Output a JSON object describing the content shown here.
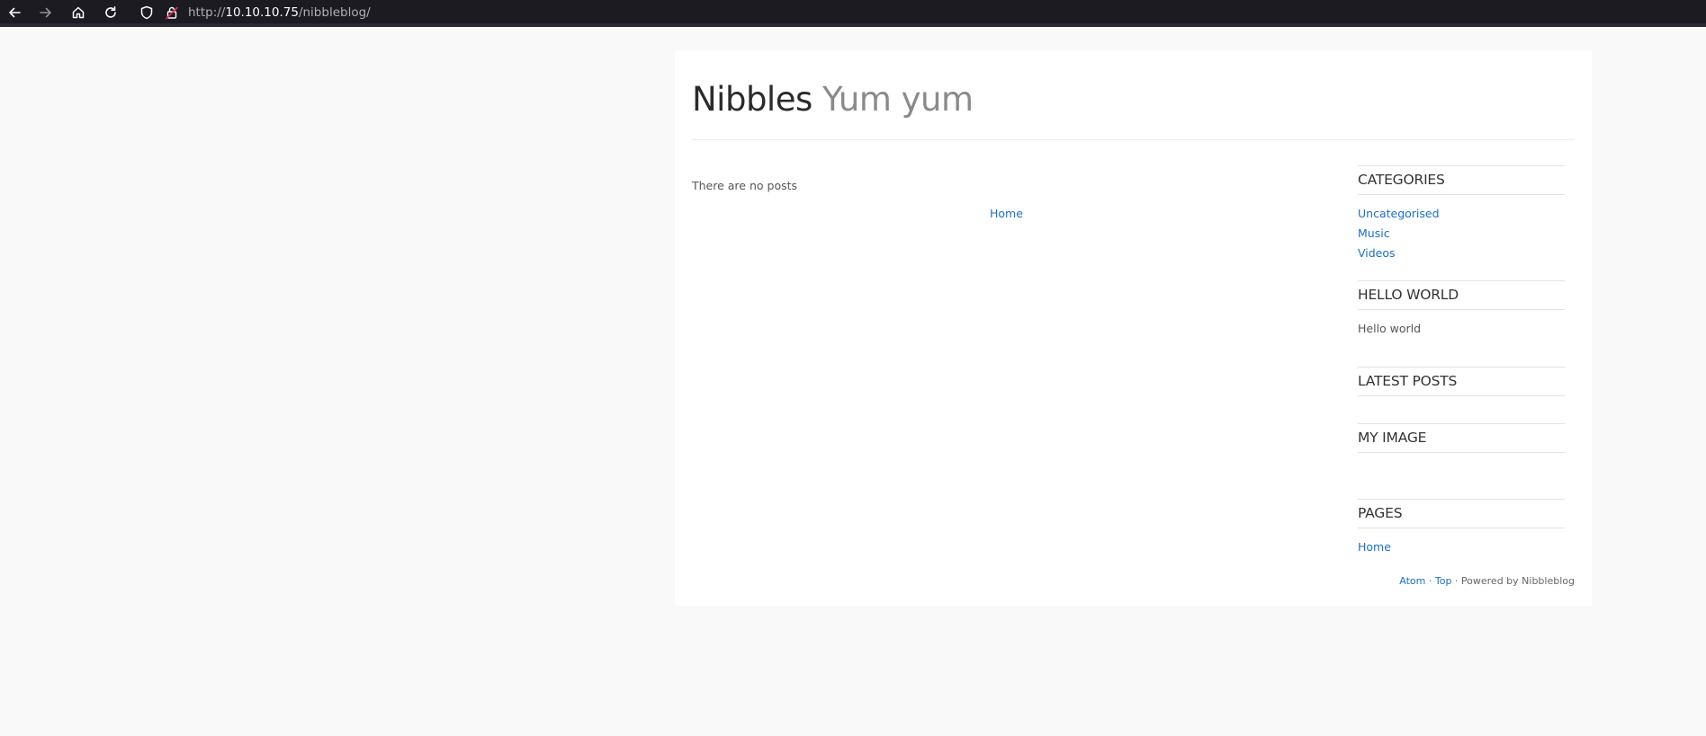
{
  "browser": {
    "url_prefix": "http://",
    "url_host": "10.10.10.75",
    "url_path": "/nibbleblog/",
    "icons": [
      "back-arrow-icon",
      "forward-arrow-icon",
      "home-icon",
      "reload-icon",
      "shield-icon",
      "insecure-lock-icon"
    ]
  },
  "blog": {
    "name": "Nibbles",
    "slogan": "Yum yum",
    "no_posts": "There are no posts",
    "pager_home": "Home"
  },
  "sidebar": {
    "categories": {
      "title": "CATEGORIES",
      "items": [
        "Uncategorised",
        "Music",
        "Videos"
      ]
    },
    "hello_world": {
      "title": "HELLO WORLD",
      "text": "Hello world"
    },
    "latest_posts": {
      "title": "LATEST POSTS"
    },
    "my_image": {
      "title": "MY IMAGE"
    },
    "pages": {
      "title": "PAGES",
      "items": [
        "Home"
      ]
    }
  },
  "footer": {
    "atom": "Atom",
    "sep1": " · ",
    "top": "Top",
    "powered": " · Powered by Nibbleblog"
  },
  "colors": {
    "link": "#1b6fc8",
    "toolbar_bg": "#1c1b22",
    "page_bg": "#f9f9f9"
  }
}
